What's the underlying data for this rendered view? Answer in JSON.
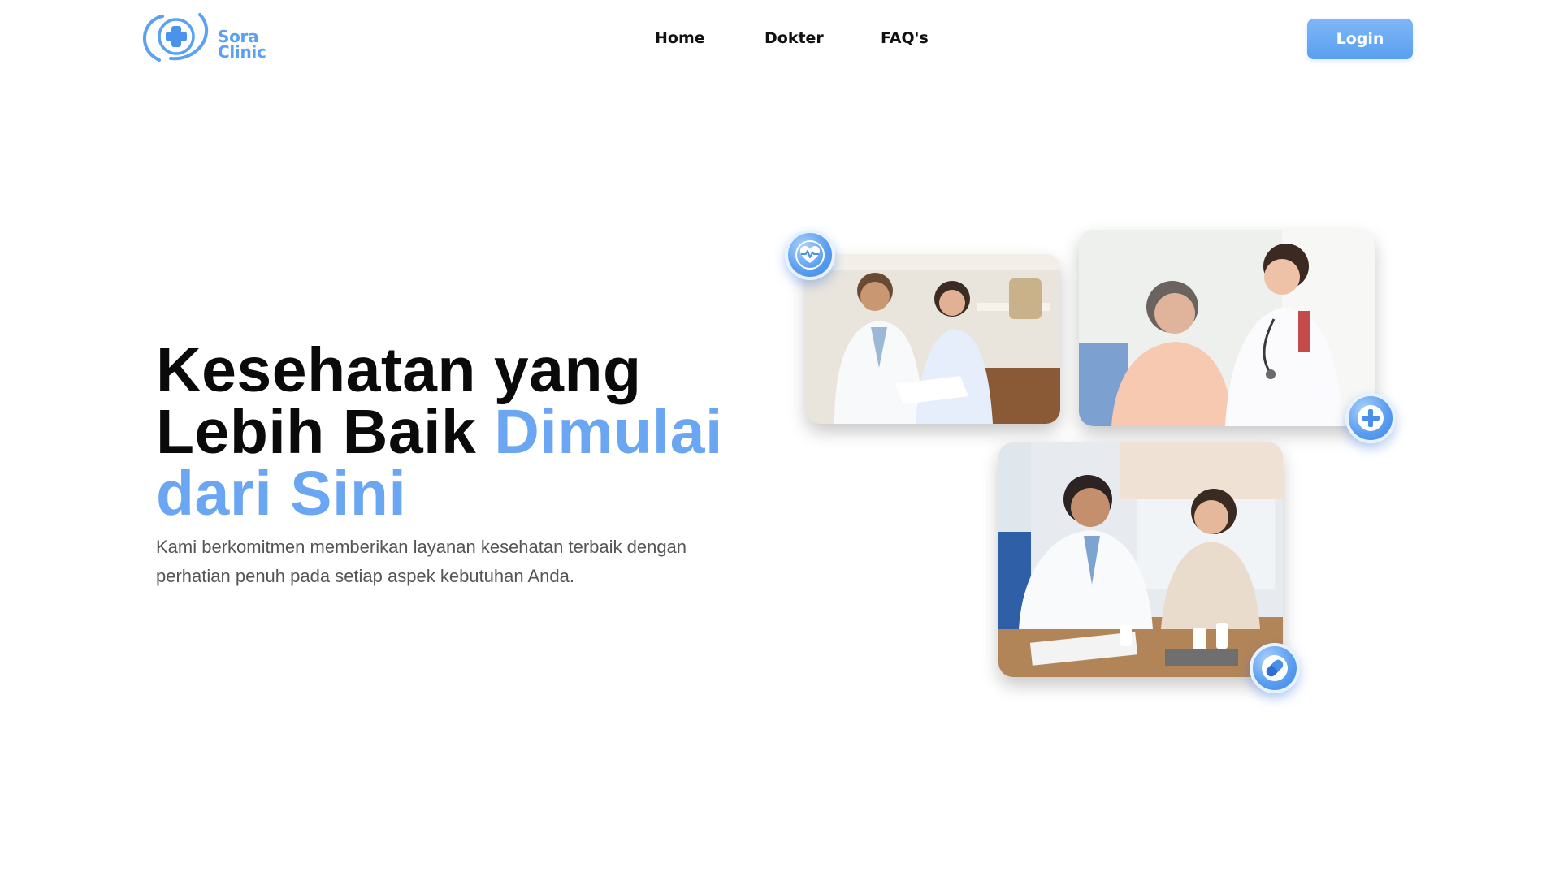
{
  "header": {
    "logo": {
      "line1": "Sora",
      "line2": "Clinic",
      "icon": "medical-cross-logo-icon"
    },
    "nav": [
      {
        "label": "Home"
      },
      {
        "label": "Dokter"
      },
      {
        "label": "FAQ's"
      }
    ],
    "login_label": "Login"
  },
  "hero": {
    "title_line1": "Kesehatan yang",
    "title_line2_dark": "Lebih Baik",
    "title_line2_accent": "Dimulai",
    "title_line3_accent": "dari Sini",
    "subtitle": "Kami berkomitmen memberikan layanan kesehatan terbaik dengan perhatian penuh pada setiap aspek kebutuhan Anda."
  },
  "images": [
    {
      "icon": "doctor-consultation-photo"
    },
    {
      "icon": "nurse-stethoscope-photo"
    },
    {
      "icon": "doctor-medication-photo"
    }
  ],
  "badges": [
    {
      "icon": "heart-pulse-icon"
    },
    {
      "icon": "plus-icon"
    },
    {
      "icon": "pill-icon"
    }
  ],
  "colors": {
    "accent": "#6aa6f1",
    "button": "#5a9ff0",
    "text_muted": "#555555"
  }
}
